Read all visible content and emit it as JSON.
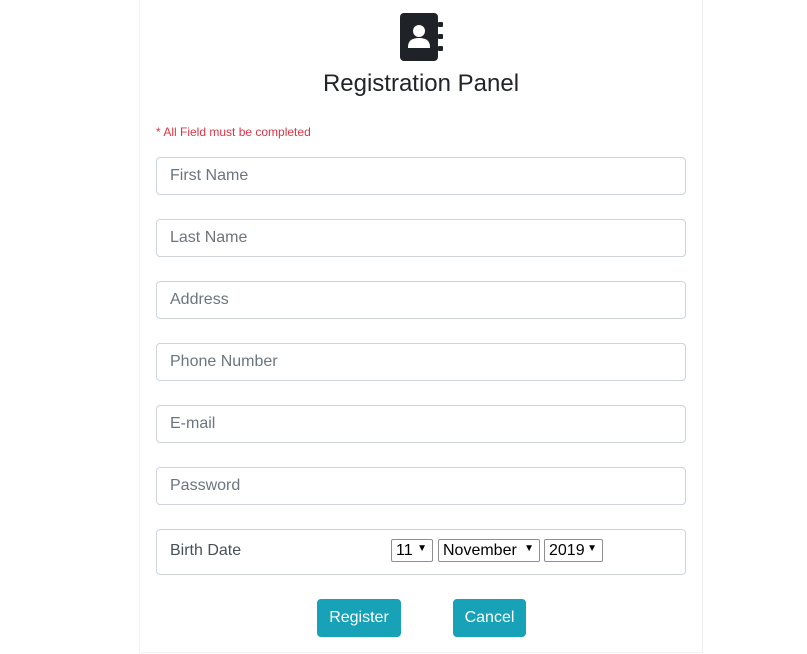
{
  "header": {
    "logo_icon": "address-book-icon",
    "title": "Registration Panel",
    "note": "* All Field must be completed"
  },
  "form": {
    "first_name_placeholder": "First Name",
    "last_name_placeholder": "Last Name",
    "address_placeholder": "Address",
    "phone_placeholder": "Phone Number",
    "email_placeholder": "E-mail",
    "password_placeholder": "Password",
    "birth_label": "Birth Date",
    "day": "11",
    "month": "November",
    "year": "2019",
    "arrow": "▼"
  },
  "buttons": {
    "register": "Register",
    "cancel": "Cancel"
  },
  "colors": {
    "accent": "#17a2b8",
    "note": "#dc3545",
    "icon": "#1f2328"
  }
}
